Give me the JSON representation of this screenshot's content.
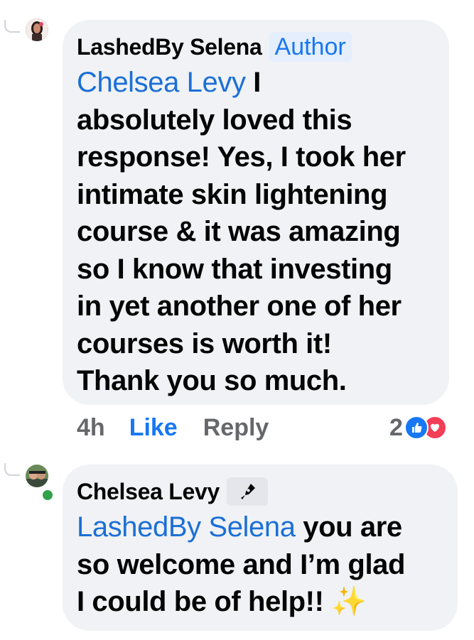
{
  "comment1": {
    "author": "LashedBy Selena",
    "badge": "Author",
    "mention": "Chelsea Levy",
    "lines": [
      " I",
      "absolutely loved this",
      "response! Yes, I took her",
      "intimate skin lightening",
      "course & it was amazing",
      "so I know that investing",
      "in yet another one of her",
      "courses is worth it!",
      "Thank you so much."
    ],
    "time": "4h",
    "like_label": "Like",
    "reply_label": "Reply",
    "reaction_count": "2",
    "reaction_icons": [
      "like-reaction-icon",
      "love-reaction-icon"
    ]
  },
  "comment2": {
    "author": "Chelsea Levy",
    "author_icon": "pen-icon",
    "mention": "LashedBy Selena",
    "lines": [
      " you are",
      "so welcome and I’m glad",
      "I could be of help!! "
    ],
    "emoji": "✨",
    "online": true
  },
  "colors": {
    "link": "#1b6fd6",
    "like": "#1877f2",
    "bubble": "#f0f2f5",
    "muted": "#65676b",
    "love": "#f33e58",
    "online": "#31a24c"
  }
}
